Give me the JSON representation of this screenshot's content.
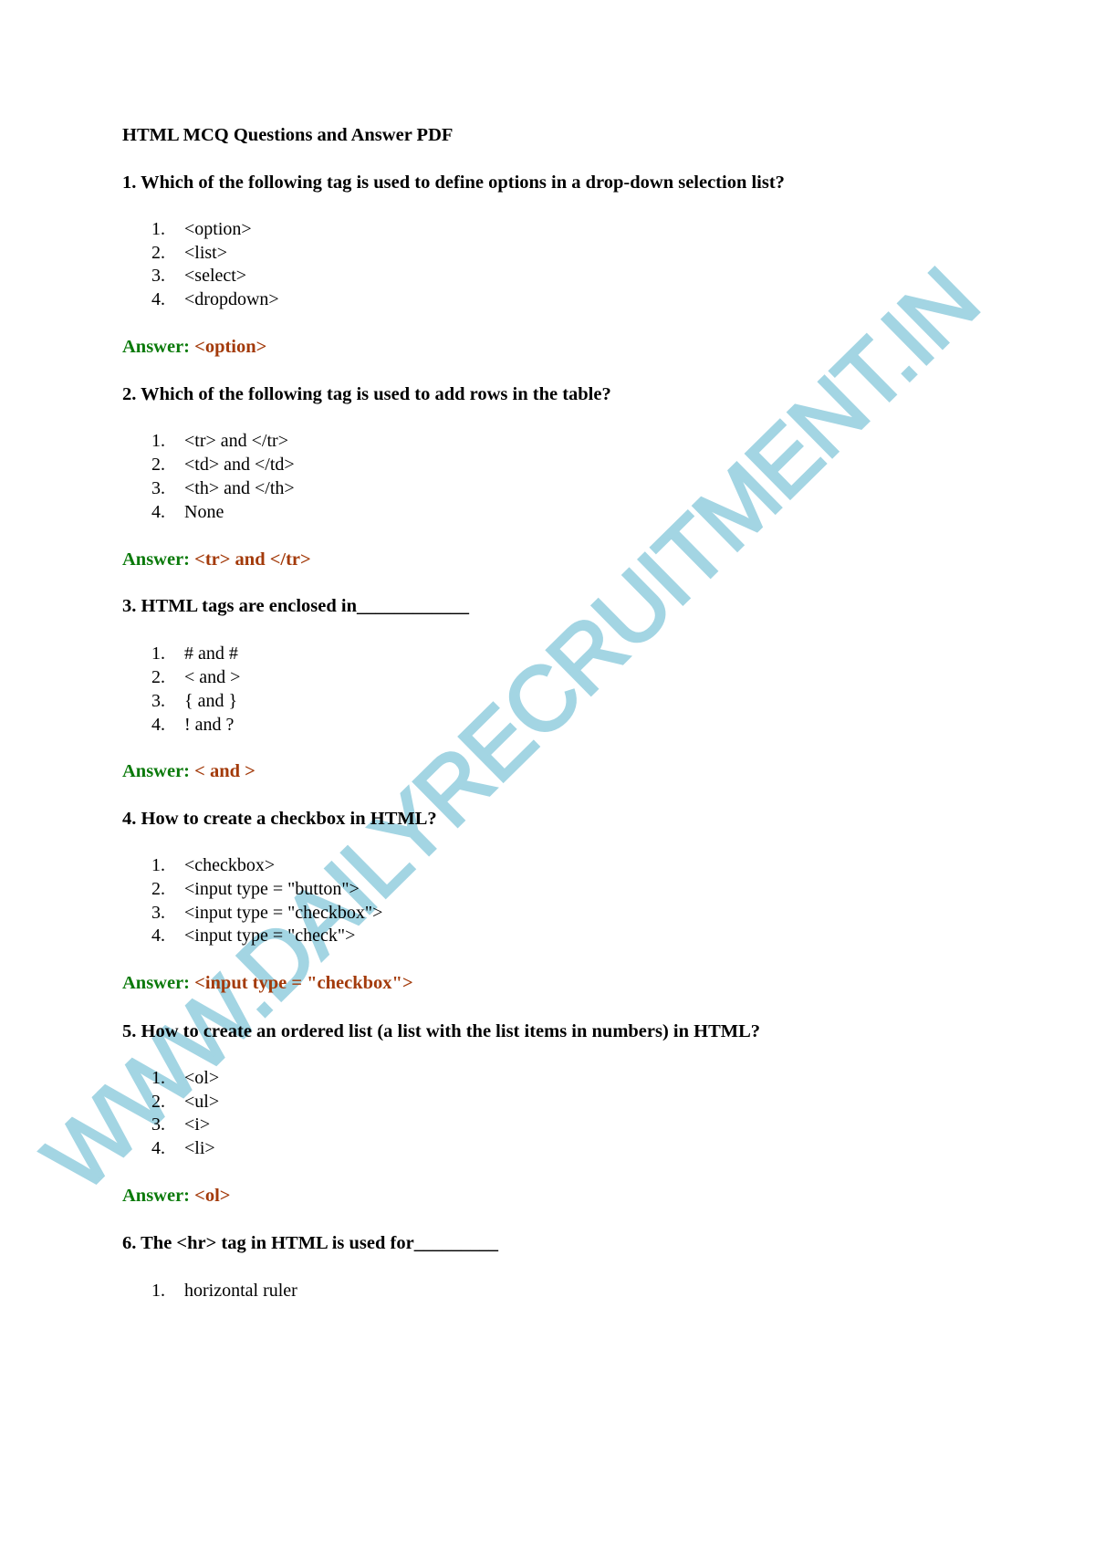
{
  "document": {
    "title": "HTML MCQ Questions and Answer PDF",
    "watermark": "WWW.DAILYRECRUITMENT.IN",
    "answer_label": "Answer:",
    "colors": {
      "answer_label": "#0b7a0b",
      "answer_value": "#a33a0a",
      "watermark": "#9fd3e2"
    },
    "questions": [
      {
        "text": "1. Which of the following tag is used to define options in a drop-down selection list?",
        "options": [
          "<option>",
          "<list>",
          "<select>",
          "<dropdown>"
        ],
        "answer": "<option>"
      },
      {
        "text": "2. Which of the following tag is used to add rows in the table?",
        "options": [
          "<tr> and </tr>",
          "<td> and </td>",
          "<th> and </th>",
          "None"
        ],
        "answer": "<tr> and </tr>"
      },
      {
        "text": "3. HTML tags are enclosed in____________",
        "options": [
          "# and #",
          "< and >",
          "{ and }",
          "! and ?"
        ],
        "answer": "< and >"
      },
      {
        "text": "4. How to create a checkbox in HTML?",
        "options": [
          "<checkbox>",
          "<input type = \"button\">",
          "<input type = \"checkbox\">",
          "<input type = \"check\">"
        ],
        "answer": "<input type = \"checkbox\">"
      },
      {
        "text": "5. How to create an ordered list (a list with the list items in numbers) in HTML?",
        "options": [
          "<ol>",
          "<ul>",
          "<i>",
          "<li>"
        ],
        "answer": "<ol>"
      },
      {
        "text": "6.  The <hr> tag in HTML is used for_________",
        "options": [
          "horizontal ruler"
        ],
        "answer": null
      }
    ],
    "option_numbers": [
      "1.",
      "2.",
      "3.",
      "4."
    ]
  }
}
